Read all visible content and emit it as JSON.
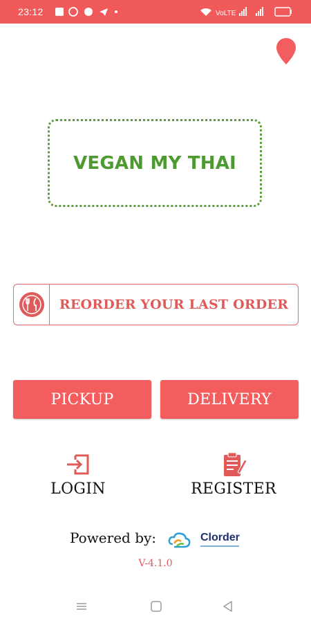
{
  "status_bar": {
    "time": "23:12",
    "battery": "21",
    "notification_icons": [
      "message-icon",
      "whatsapp-icon",
      "skype-icon",
      "telegram-icon",
      "dot-icon"
    ],
    "system_icons": [
      "wifi-icon",
      "volte-icon",
      "signal-icon",
      "signal-icon",
      "battery-icon"
    ]
  },
  "header": {
    "location_icon": "map-pin-icon"
  },
  "brand": {
    "name": "VEGAN MY THAI",
    "color": "#4e9a32"
  },
  "reorder": {
    "label": "REORDER YOUR LAST ORDER",
    "icon": "fork-knife-icon"
  },
  "order_buttons": {
    "pickup": "PICKUP",
    "delivery": "DELIVERY"
  },
  "account": {
    "login_label": "LOGIN",
    "login_icon": "login-icon",
    "register_label": "REGISTER",
    "register_icon": "register-clipboard-icon"
  },
  "footer": {
    "powered_by": "Powered by:",
    "logo_text": "Clorder",
    "version": "V-4.1.0"
  },
  "nav_bar": {
    "items": [
      "menu-icon",
      "home-icon",
      "back-icon"
    ]
  },
  "colors": {
    "accent": "#f45d5d",
    "status_bar": "#f15a5a",
    "brand_green": "#4e9a32"
  }
}
